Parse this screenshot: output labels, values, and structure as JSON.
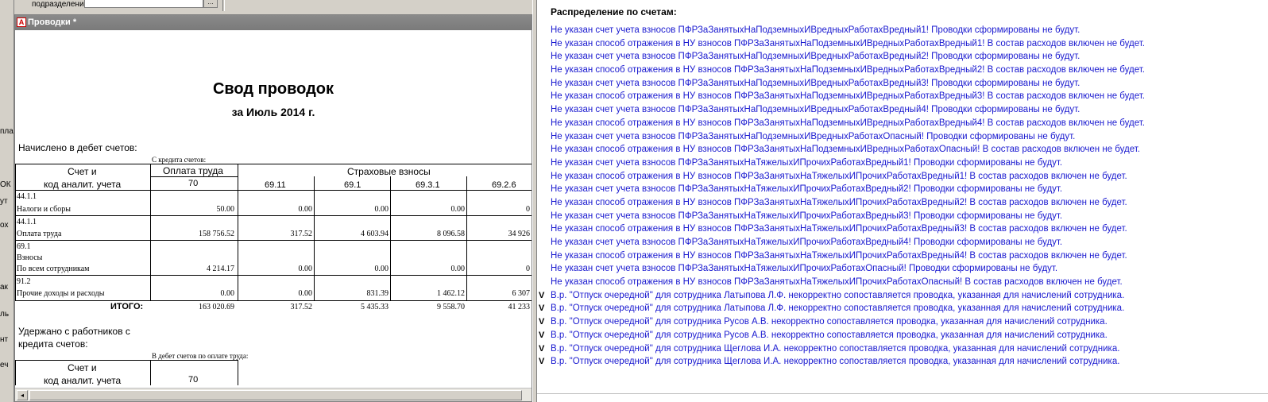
{
  "background_window": {
    "top_label": "подразделение:",
    "side_labels": [
      "пла",
      "",
      "ОК",
      "ут",
      "ох",
      "ак",
      "ль",
      "нт",
      "еч"
    ]
  },
  "report_window": {
    "title": "Проводки *",
    "report_title": "Свод проводок",
    "report_subtitle": "за Июль 2014 г.",
    "section_debit": "Начислено в дебет счетов:",
    "credit_caption": "С кредита счетов:",
    "col_account_line1": "Счет и",
    "col_account_line2": "код аналит. учета",
    "col_salary": "Оплата труда",
    "col_salary_code": "70",
    "col_insurance": "Страховые взносы",
    "insurance_codes": [
      "69.11",
      "69.1",
      "69.3.1",
      "69.2.6"
    ],
    "rows": [
      {
        "code": "44.1.1",
        "lines": [
          "Налоги и сборы"
        ],
        "values": [
          "50.00",
          "0.00",
          "0.00",
          "0.00",
          "0"
        ]
      },
      {
        "code": "44.1.1",
        "lines": [
          "Оплата труда"
        ],
        "values": [
          "158 756.52",
          "317.52",
          "4 603.94",
          "8 096.58",
          "34 926"
        ]
      },
      {
        "code": "69.1",
        "lines": [
          "Взносы",
          "По всем сотрудникам"
        ],
        "values": [
          "4 214.17",
          "0.00",
          "0.00",
          "0.00",
          "0"
        ]
      },
      {
        "code": "91.2",
        "lines": [
          "Прочие доходы и расходы"
        ],
        "values": [
          "0.00",
          "0.00",
          "831.39",
          "1 462.12",
          "6 307"
        ]
      }
    ],
    "total_label": "ИТОГО:",
    "total_values": [
      "163 020.69",
      "317.52",
      "5 435.33",
      "9 558.70",
      "41 233"
    ],
    "section_withheld_line1": "Удержано с работников с",
    "section_withheld_line2": "кредита счетов:",
    "debit_caption": "В дебет счетов по оплате труда:",
    "bottom_col_account_line1": "Счет и",
    "bottom_col_account_line2": "код аналит. учета",
    "bottom_col_salary_code": "70"
  },
  "messages": {
    "header": "Распределение по счетам:",
    "items": [
      {
        "mark": "",
        "text": "Не указан счет учета взносов ПФРЗаЗанятыхНаПодземныхИВредныхРаботахВредный1! Проводки сформированы не будут."
      },
      {
        "mark": "",
        "text": "Не указан способ отражения в НУ взносов ПФРЗаЗанятыхНаПодземныхИВредныхРаботахВредный1! В состав расходов включен не будет."
      },
      {
        "mark": "",
        "text": "Не указан счет учета взносов ПФРЗаЗанятыхНаПодземныхИВредныхРаботахВредный2! Проводки сформированы не будут."
      },
      {
        "mark": "",
        "text": "Не указан способ отражения в НУ взносов ПФРЗаЗанятыхНаПодземныхИВредныхРаботахВредный2! В состав расходов включен не будет."
      },
      {
        "mark": "",
        "text": "Не указан счет учета взносов ПФРЗаЗанятыхНаПодземныхИВредныхРаботахВредный3! Проводки сформированы не будут."
      },
      {
        "mark": "",
        "text": "Не указан способ отражения в НУ взносов ПФРЗаЗанятыхНаПодземныхИВредныхРаботахВредный3! В состав расходов включен не будет."
      },
      {
        "mark": "",
        "text": "Не указан счет учета взносов ПФРЗаЗанятыхНаПодземныхИВредныхРаботахВредный4! Проводки сформированы не будут."
      },
      {
        "mark": "",
        "text": "Не указан способ отражения в НУ взносов ПФРЗаЗанятыхНаПодземныхИВредныхРаботахВредный4! В состав расходов включен не будет."
      },
      {
        "mark": "",
        "text": "Не указан счет учета взносов ПФРЗаЗанятыхНаПодземныхИВредныхРаботахОпасный! Проводки сформированы не будут."
      },
      {
        "mark": "",
        "text": "Не указан способ отражения в НУ взносов ПФРЗаЗанятыхНаПодземныхИВредныхРаботахОпасный! В состав расходов включен не будет."
      },
      {
        "mark": "",
        "text": "Не указан счет учета взносов ПФРЗаЗанятыхНаТяжелыхИПрочихРаботахВредный1! Проводки сформированы не будут."
      },
      {
        "mark": "",
        "text": "Не указан способ отражения в НУ взносов ПФРЗаЗанятыхНаТяжелыхИПрочихРаботахВредный1! В состав расходов включен не будет."
      },
      {
        "mark": "",
        "text": "Не указан счет учета взносов ПФРЗаЗанятыхНаТяжелыхИПрочихРаботахВредный2! Проводки сформированы не будут."
      },
      {
        "mark": "",
        "text": "Не указан способ отражения в НУ взносов ПФРЗаЗанятыхНаТяжелыхИПрочихРаботахВредный2! В состав расходов включен не будет."
      },
      {
        "mark": "",
        "text": "Не указан счет учета взносов ПФРЗаЗанятыхНаТяжелыхИПрочихРаботахВредный3! Проводки сформированы не будут."
      },
      {
        "mark": "",
        "text": "Не указан способ отражения в НУ взносов ПФРЗаЗанятыхНаТяжелыхИПрочихРаботахВредный3! В состав расходов включен не будет."
      },
      {
        "mark": "",
        "text": "Не указан счет учета взносов ПФРЗаЗанятыхНаТяжелыхИПрочихРаботахВредный4! Проводки сформированы не будут."
      },
      {
        "mark": "",
        "text": "Не указан способ отражения в НУ взносов ПФРЗаЗанятыхНаТяжелыхИПрочихРаботахВредный4! В состав расходов включен не будет."
      },
      {
        "mark": "",
        "text": "Не указан счет учета взносов ПФРЗаЗанятыхНаТяжелыхИПрочихРаботахОпасный! Проводки сформированы не будут."
      },
      {
        "mark": "",
        "text": "Не указан способ отражения в НУ взносов ПФРЗаЗанятыхНаТяжелыхИПрочихРаботахОпасный! В состав расходов включен не будет."
      },
      {
        "mark": "V",
        "text": "В.р. \"Отпуск очередной\" для сотрудника Латыпова Л.Ф. некорректно сопоставляется проводка, указанная для начислений сотрудника."
      },
      {
        "mark": "V",
        "text": "В.р. \"Отпуск очередной\" для сотрудника Латыпова Л.Ф. некорректно сопоставляется проводка, указанная для начислений сотрудника."
      },
      {
        "mark": "V",
        "text": "В.р. \"Отпуск очередной\" для сотрудника Русов А.В. некорректно сопоставляется проводка, указанная для начислений сотрудника."
      },
      {
        "mark": "V",
        "text": "В.р. \"Отпуск очередной\" для сотрудника Русов А.В. некорректно сопоставляется проводка, указанная для начислений сотрудника."
      },
      {
        "mark": "V",
        "text": "В.р. \"Отпуск очередной\" для сотрудника Щеглова И.А. некорректно сопоставляется проводка, указанная для начислений сотрудника."
      },
      {
        "mark": "V",
        "text": "В.р. \"Отпуск очередной\" для сотрудника Щеглова И.А. некорректно сопоставляется проводка, указанная для начислений сотрудника."
      }
    ]
  },
  "colors": {
    "message_text": "#1a1ad0",
    "titlebar_inactive": "#808080"
  }
}
